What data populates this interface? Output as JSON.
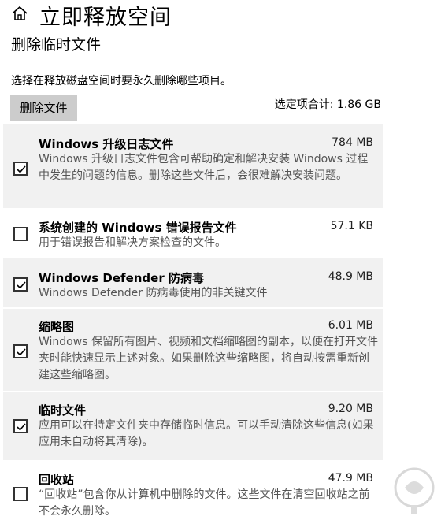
{
  "header": {
    "title": "立即释放空间",
    "icon": "home-icon"
  },
  "subtitle": "删除临时文件",
  "description": "选择在释放磁盘空间时要永久删除哪些项目。",
  "delete_button": "删除文件",
  "total": "选定项合计: 1.86 GB",
  "items": [
    {
      "title": "Windows 升级日志文件",
      "size": "784 MB",
      "checked": true,
      "description": "Windows 升级日志文件包含可帮助确定和解决安装 Windows 过程中发生的问题的信息。删除这些文件后，会很难解决安装问题。"
    },
    {
      "title": "系统创建的 Windows 错误报告文件",
      "size": "57.1 KB",
      "checked": false,
      "description": "用于错误报告和解决方案检查的文件。"
    },
    {
      "title": "Windows Defender 防病毒",
      "size": "48.9 MB",
      "checked": true,
      "description": "Windows Defender 防病毒使用的非关键文件"
    },
    {
      "title": "缩略图",
      "size": "6.01 MB",
      "checked": true,
      "description": "Windows 保留所有图片、视频和文档缩略图的副本，以便在打开文件夹时能快速显示上述对象。如果删除这些缩略图，将自动按需重新创建这些缩略图。"
    },
    {
      "title": "临时文件",
      "size": "9.20 MB",
      "checked": true,
      "description": "应用可以在特定文件夹中存储临时信息。可以手动清除这些信息(如果应用未自动将其清除)。"
    },
    {
      "title": "回收站",
      "size": "47.9 MB",
      "checked": false,
      "description": "“回收站”包含你从计算机中删除的文件。这些文件在清空回收站之前不会永久删除。"
    }
  ],
  "colors": {
    "selected_bg": "#f1f1f1",
    "button_bg": "#cccccc",
    "desc_text": "#555555"
  }
}
